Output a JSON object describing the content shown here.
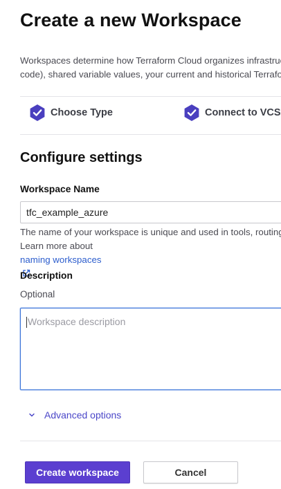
{
  "page": {
    "title": "Create a new Workspace",
    "intro_line1": "Workspaces determine how Terraform Cloud organizes infrastructure",
    "intro_line2": "code), shared variable values, your current and historical Terraform"
  },
  "steps": [
    {
      "label": "Choose Type",
      "icon": "check-badge-icon",
      "status": "complete"
    },
    {
      "label": "Connect to VCS",
      "icon": "check-badge-icon",
      "status": "complete"
    }
  ],
  "settings": {
    "section_title": "Configure settings",
    "workspace_name": {
      "label": "Workspace Name",
      "value": "tfc_example_azure",
      "help_line1": "The name of your workspace is unique and used in tools, routing",
      "help_line2_prefix": "Learn more about ",
      "help_link": "naming workspaces",
      "help_line2_suffix": "."
    },
    "description": {
      "label": "Description",
      "optional_text": "Optional",
      "placeholder": "Workspace description",
      "value": ""
    },
    "advanced_toggle": "Advanced options"
  },
  "actions": {
    "create_label": "Create workspace",
    "cancel_label": "Cancel"
  },
  "colors": {
    "primary": "#5b3fd0",
    "step_badge": "#4a3fbf",
    "link": "#2c5dcd",
    "focus_border": "#3872d8"
  }
}
